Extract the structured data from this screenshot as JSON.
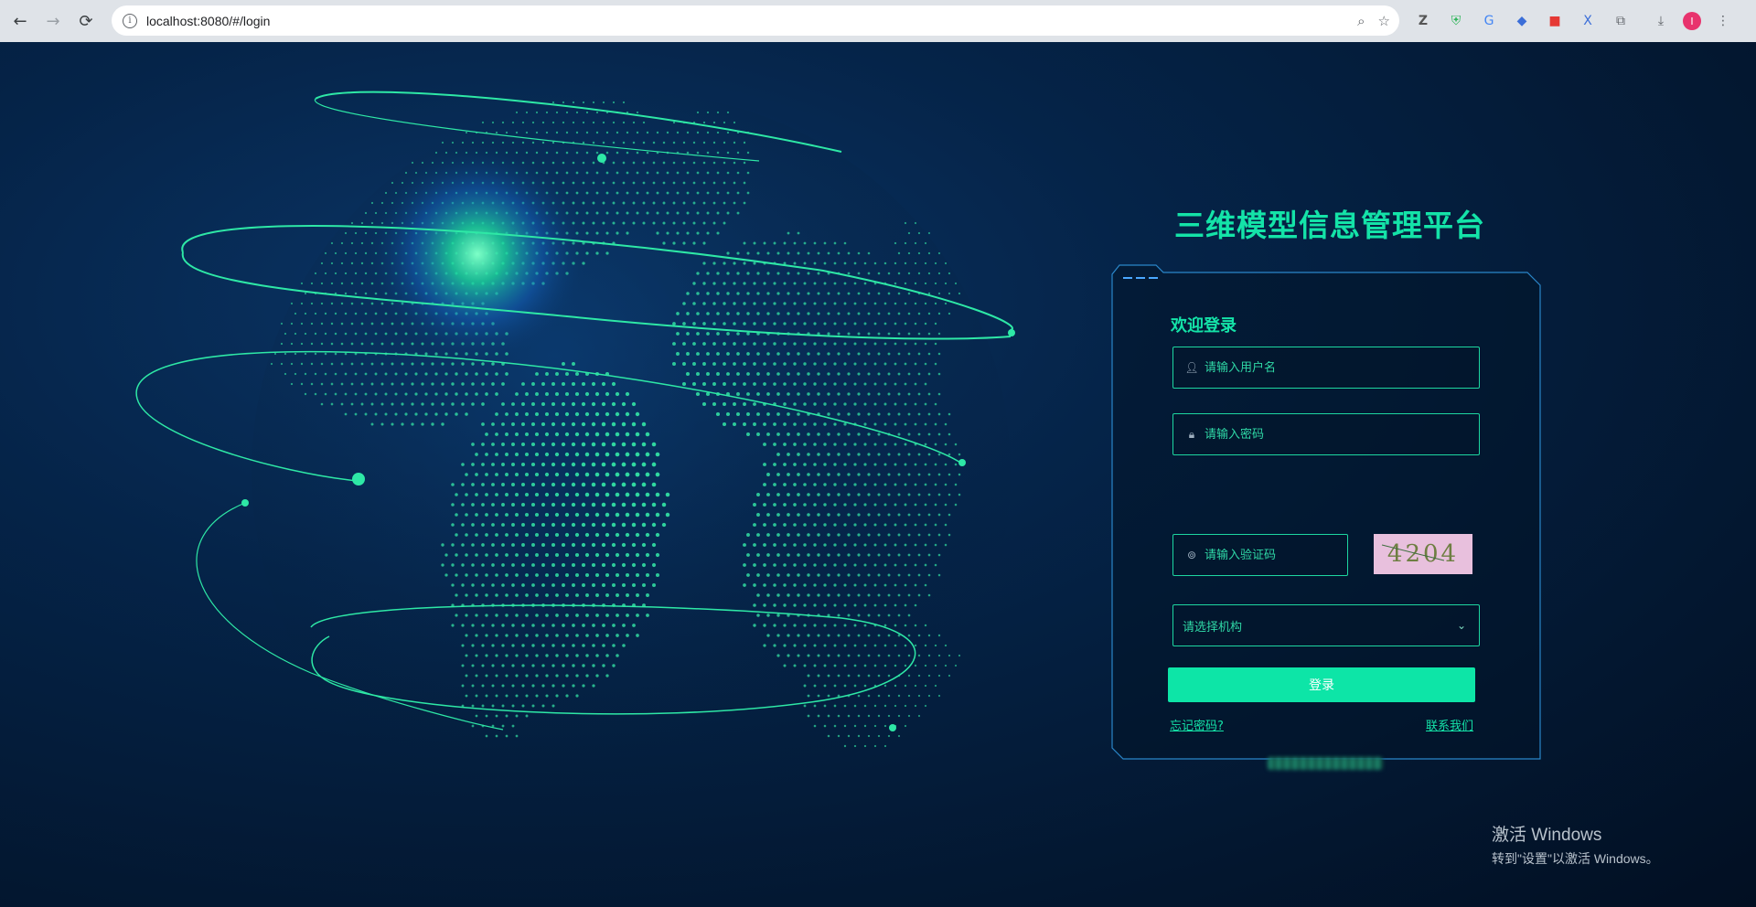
{
  "browser": {
    "url": "localhost:8080/#/login"
  },
  "login": {
    "title": "三维模型信息管理平台",
    "welcome": "欢迎登录",
    "username_placeholder": "请输入用户名",
    "password_placeholder": "请输入密码",
    "captcha_placeholder": "请输入验证码",
    "captcha_code": "4204",
    "org_placeholder": "请选择机构",
    "login_button": "登录",
    "forgot_password": "忘记密码?",
    "contact_us": "联系我们"
  },
  "windows_watermark": {
    "line1": "激活 Windows",
    "line2": "转到\"设置\"以激活 Windows。"
  },
  "colors": {
    "accent": "#14e3a8",
    "background": "#041a33",
    "button": "#0de5a7"
  }
}
